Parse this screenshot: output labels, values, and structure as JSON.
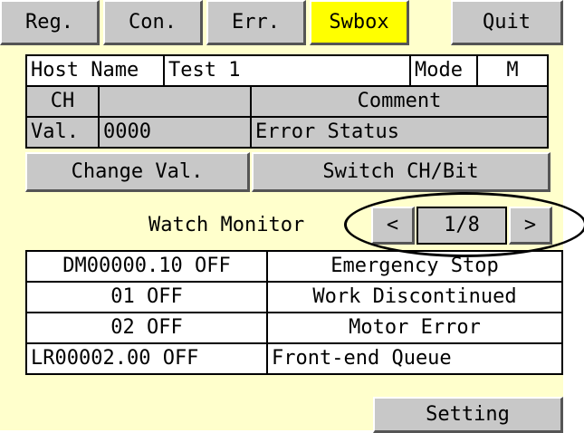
{
  "tabs": {
    "reg": "Reg.",
    "con": "Con.",
    "err": "Err.",
    "swbox": "Swbox",
    "quit": "Quit"
  },
  "header": {
    "host_name_label": "Host Name",
    "host_name_value": "Test 1",
    "mode_label": "Mode",
    "mode_value": "M"
  },
  "grid": {
    "ch_label": "CH",
    "ch_value": "",
    "comment_label": "Comment",
    "val_label": "Val.",
    "val_value": "0000",
    "error_status": "Error  Status"
  },
  "actions": {
    "change_val": "Change Val.",
    "switch_ch_bit": "Switch CH/Bit"
  },
  "monitor": {
    "title": "Watch  Monitor",
    "prev": "<",
    "page": "1/8",
    "next": ">"
  },
  "rows": [
    {
      "address": "DM00000.10 OFF",
      "comment": "Emergency Stop"
    },
    {
      "address": "01 OFF",
      "comment": "Work Discontinued"
    },
    {
      "address": "02 OFF",
      "comment": "Motor Error"
    },
    {
      "address": "LR00002.00 OFF",
      "comment": "Front-end Queue"
    }
  ],
  "footer": {
    "setting": "Setting"
  },
  "colors": {
    "panel_bg": "#ffffcc",
    "button_gray": "#c8c8c8",
    "active_tab": "#ffff00"
  }
}
